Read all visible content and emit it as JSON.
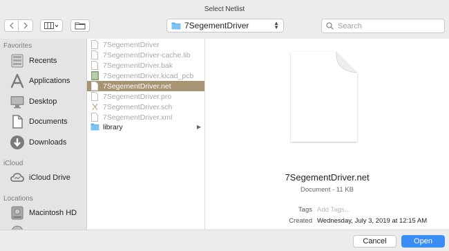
{
  "window": {
    "title": "Select Netlist"
  },
  "toolbar": {
    "location": "7SegementDriver",
    "search_placeholder": "Search"
  },
  "sidebar": {
    "sections": [
      {
        "title": "Favorites",
        "items": [
          "Recents",
          "Applications",
          "Desktop",
          "Documents",
          "Downloads"
        ]
      },
      {
        "title": "iCloud",
        "items": [
          "iCloud Drive"
        ]
      },
      {
        "title": "Locations",
        "items": [
          "Macintosh HD"
        ]
      }
    ]
  },
  "files": [
    {
      "name": "7SegementDriver",
      "state": "disabled",
      "icon": "blank-file-icon"
    },
    {
      "name": "7SegementDriver-cache.lib",
      "state": "disabled",
      "icon": "blank-file-icon"
    },
    {
      "name": "7SegementDriver.bak",
      "state": "disabled",
      "icon": "blank-file-icon"
    },
    {
      "name": "7SegementDriver.kicad_pcb",
      "state": "disabled",
      "icon": "pcb-file-icon"
    },
    {
      "name": "7SegementDriver.net",
      "state": "selected",
      "icon": "document-icon"
    },
    {
      "name": "7SegementDriver.pro",
      "state": "disabled",
      "icon": "blank-file-icon"
    },
    {
      "name": "7SegementDriver.sch",
      "state": "disabled",
      "icon": "schematic-file-icon"
    },
    {
      "name": "7SegementDriver.xml",
      "state": "disabled",
      "icon": "blank-file-icon"
    },
    {
      "name": "library",
      "state": "folder",
      "icon": "folder-icon"
    }
  ],
  "preview": {
    "name": "7SegementDriver.net",
    "kind": "Document - 11 KB",
    "tags_label": "Tags",
    "tags_placeholder": "Add Tags...",
    "created_label": "Created",
    "created_value": "Wednesday, July 3, 2019 at 12:15 AM"
  },
  "buttons": {
    "cancel": "Cancel",
    "open": "Open"
  },
  "colors": {
    "selection": "#a79473",
    "accent": "#3b8df6",
    "folder": "#62b3ea"
  }
}
